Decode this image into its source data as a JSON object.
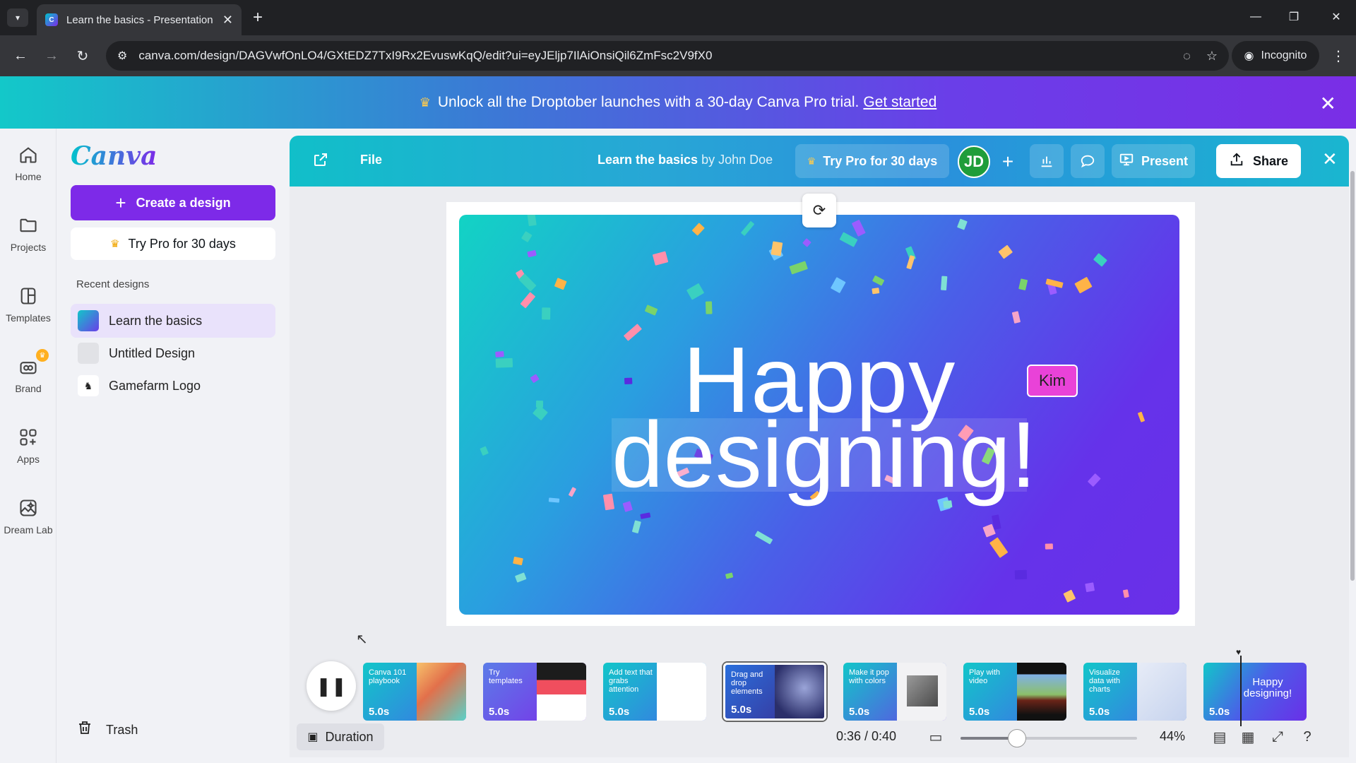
{
  "browser": {
    "tab_title": "Learn the basics - Presentation",
    "url": "canva.com/design/DAGVwfOnLO4/GXtEDZ7TxI9Rx2EvuswKqQ/edit?ui=eyJEljp7IlAiOnsiQil6ZmFsc2V9fX0",
    "incognito_label": "Incognito"
  },
  "promo": {
    "text": "Unlock all the Droptober launches with a 30-day Canva Pro trial.",
    "link": "Get started"
  },
  "rail": {
    "items": [
      {
        "label": "Home",
        "icon": "home-icon"
      },
      {
        "label": "Projects",
        "icon": "folder-icon"
      },
      {
        "label": "Templates",
        "icon": "templates-icon"
      },
      {
        "label": "Brand",
        "icon": "brand-icon"
      },
      {
        "label": "Apps",
        "icon": "apps-icon"
      },
      {
        "label": "Dream Lab",
        "icon": "dream-lab-icon"
      }
    ]
  },
  "panel": {
    "logo": "Canva",
    "create_label": "Create a design",
    "pro_label": "Try Pro for 30 days",
    "recent_title": "Recent designs",
    "recent": [
      {
        "label": "Learn the basics",
        "active": true
      },
      {
        "label": "Untitled Design",
        "active": false
      },
      {
        "label": "Gamefarm Logo",
        "active": false
      }
    ],
    "trash_label": "Trash"
  },
  "editor": {
    "file_label": "File",
    "title": "Learn the basics",
    "by_author": "by John Doe",
    "pro_label": "Try Pro for 30 days",
    "avatar_initials": "JD",
    "present_label": "Present",
    "share_label": "Share"
  },
  "slide": {
    "line1": "Happy",
    "line2": "designing!",
    "collaborator": "Kim"
  },
  "timeline": {
    "thumbnails": [
      {
        "label": "Canva 101 playbook",
        "duration": "5.0s",
        "selected": false
      },
      {
        "label": "Try templates",
        "duration": "5.0s",
        "selected": false
      },
      {
        "label": "Add text that grabs attention",
        "duration": "5.0s",
        "selected": false
      },
      {
        "label": "Drag and drop elements",
        "duration": "5.0s",
        "selected": true
      },
      {
        "label": "Make it pop with colors",
        "duration": "5.0s",
        "selected": false
      },
      {
        "label": "Play with video",
        "duration": "5.0s",
        "selected": false
      },
      {
        "label": "Visualize data with charts",
        "duration": "5.0s",
        "selected": false
      },
      {
        "label": "Happy designing!",
        "duration": "5.0s",
        "selected": false
      }
    ]
  },
  "footer": {
    "duration_label": "Duration",
    "time": "0:36 / 0:40",
    "zoom": "44%",
    "zoom_fraction": 0.32
  },
  "colors": {
    "brand_purple": "#7d2ae8",
    "brand_teal": "#00c4cc",
    "avatar_green": "#1f9d3a",
    "collaborator_pink": "#e942d8"
  }
}
